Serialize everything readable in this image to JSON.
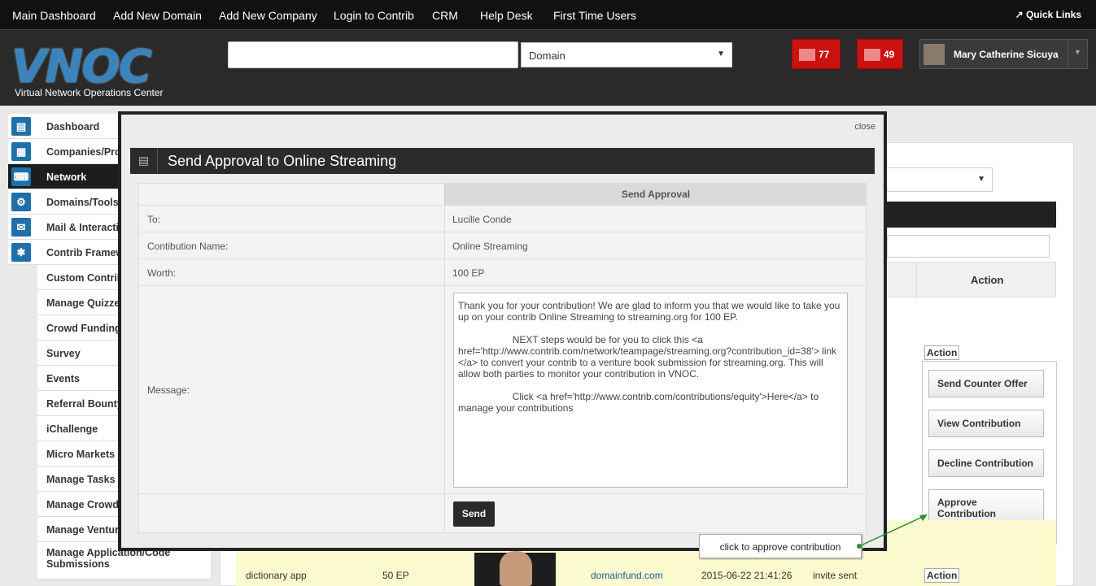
{
  "topnav": {
    "items": [
      "Main Dashboard",
      "Add New Domain",
      "Add New Company",
      "Login to Contrib",
      "CRM",
      "Help Desk",
      "First Time Users"
    ],
    "quick_links": "Quick Links"
  },
  "header": {
    "logo": "VNOC",
    "logo_sub": "Virtual Network Operations Center",
    "search_value": "",
    "select_value": "Domain",
    "badge1": "77",
    "badge2": "49",
    "user_name": "Mary Catherine Sicuya"
  },
  "sidebar": {
    "items": [
      {
        "label": "Dashboard",
        "icon": "chart-icon"
      },
      {
        "label": "Companies/Pro",
        "icon": "building-icon"
      },
      {
        "label": "Network",
        "icon": "keyboard-icon"
      },
      {
        "label": "Domains/Tools",
        "icon": "gear-icon"
      },
      {
        "label": "Mail & Interactio",
        "icon": "mail-icon"
      },
      {
        "label": "Contrib Framew",
        "icon": "puzzle-icon"
      }
    ],
    "subitems": [
      "Custom Contrib",
      "Manage Quizzes",
      "Crowd Funding",
      "Survey",
      "Events",
      "Referral Bounty",
      "iChallenge",
      "Micro Markets",
      "Manage Tasks",
      "Manage Crowdt",
      "Manage Venture",
      "Manage Application/Code Submissions"
    ]
  },
  "bg": {
    "action_header": "Action",
    "action1": "Action",
    "action2": "Action",
    "dropdown": [
      "Send Counter Offer",
      "View Contribution",
      "Decline Contribution",
      "Approve Contribution"
    ],
    "row": {
      "name": "dictionary app",
      "worth": "50 EP",
      "domain": "domainfund.com",
      "date": "2015-06-22 21:41:26",
      "status": "invite sent"
    }
  },
  "modal": {
    "close": "close",
    "title": "Send Approval to Online Streaming",
    "header": "Send Approval",
    "to_label": "To:",
    "to_value": "Lucille Conde",
    "contrib_label": "Contibution Name:",
    "contrib_value": "Online Streaming",
    "worth_label": "Worth:",
    "worth_value": "100 EP",
    "message_label": "Message:",
    "message": "Thank you for your contribution! We are glad to inform you that we would like to take you up on your contrib Online Streaming to streaming.org for 100 EP.\n\n                    NEXT steps would be for you to click this <a href='http://www.contrib.com/network/teampage/streaming.org?contribution_id=38'> link </a> to convert your contrib to a venture book submission for streaming.org. This will allow both parties to monitor your contribution in VNOC.\n\n                    Click <a href='http://www.contrib.com/contributions/equity'>Here</a> to manage your contributions",
    "send": "Send"
  },
  "tooltip": "click to approve contribution",
  "colors": {
    "accent_red": "#cc1111",
    "dark": "#222222",
    "highlight": "#fcfbcf",
    "arrow": "#2e8b2e"
  }
}
